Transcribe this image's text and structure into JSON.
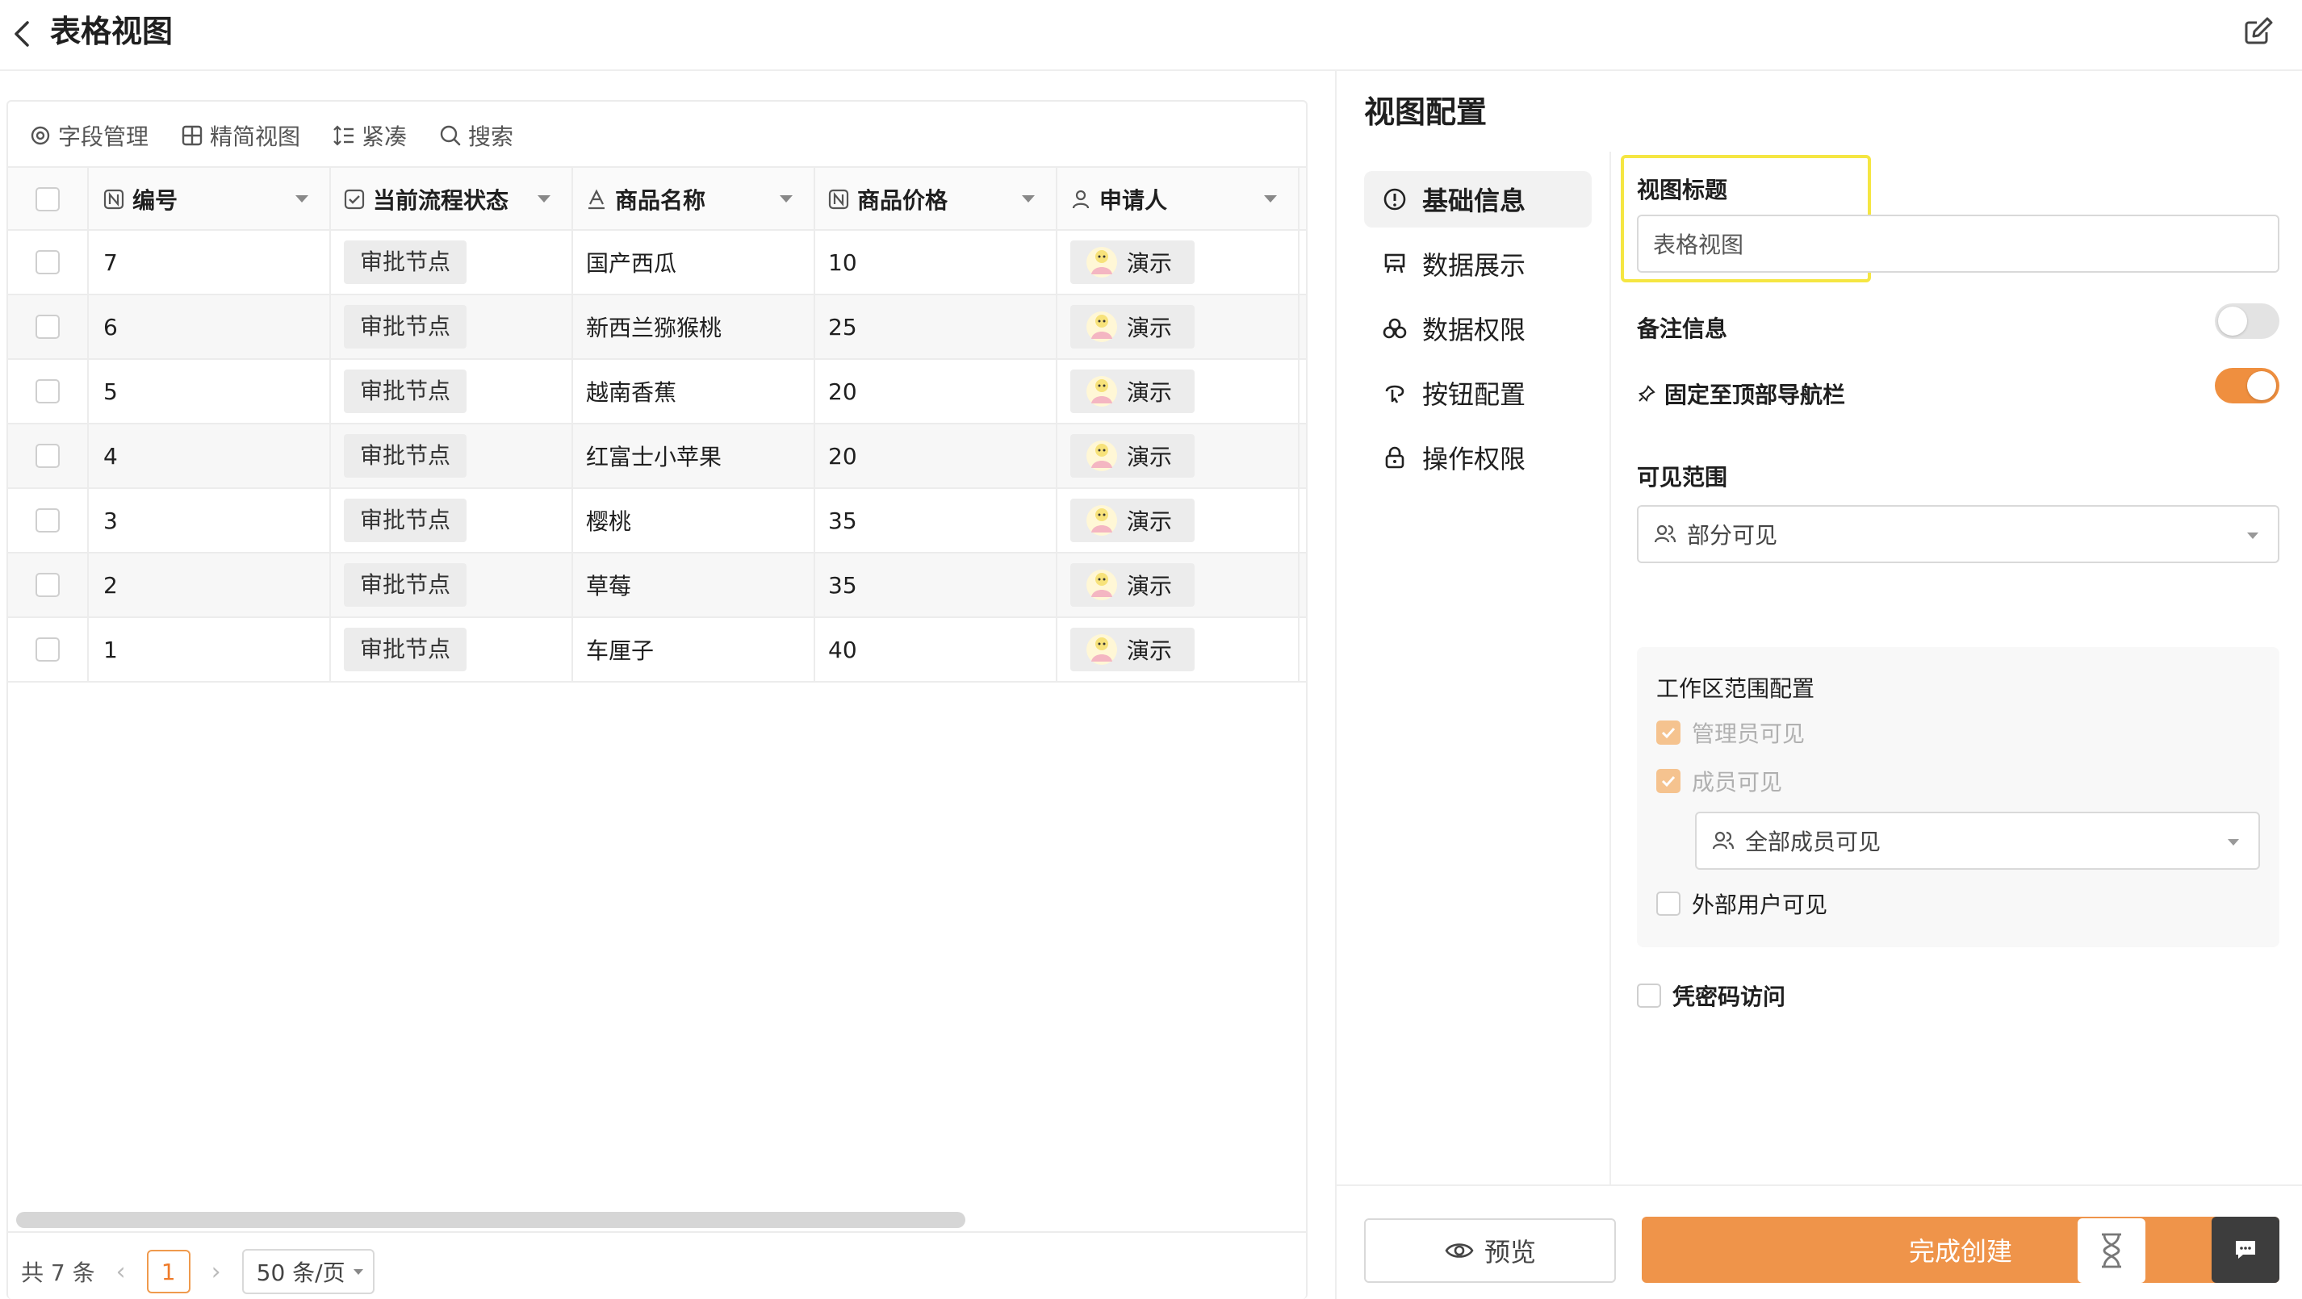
{
  "header": {
    "title": "表格视图",
    "back_icon": "chevron-left-icon",
    "edit_icon": "edit-icon"
  },
  "toolbar": {
    "fields": "字段管理",
    "simple_view": "精简视图",
    "compact": "紧凑",
    "search": "搜索"
  },
  "table": {
    "columns": [
      {
        "label": "编号",
        "icon": "number-field-icon"
      },
      {
        "label": "当前流程状态",
        "icon": "status-field-icon"
      },
      {
        "label": "商品名称",
        "icon": "text-field-icon"
      },
      {
        "label": "商品价格",
        "icon": "number-field-icon"
      },
      {
        "label": "申请人",
        "icon": "user-field-icon"
      }
    ],
    "rows": [
      {
        "id": "7",
        "status": "审批节点",
        "name": "国产西瓜",
        "price": "10",
        "applicant": "演示"
      },
      {
        "id": "6",
        "status": "审批节点",
        "name": "新西兰猕猴桃",
        "price": "25",
        "applicant": "演示"
      },
      {
        "id": "5",
        "status": "审批节点",
        "name": "越南香蕉",
        "price": "20",
        "applicant": "演示"
      },
      {
        "id": "4",
        "status": "审批节点",
        "name": "红富士小苹果",
        "price": "20",
        "applicant": "演示"
      },
      {
        "id": "3",
        "status": "审批节点",
        "name": "樱桃",
        "price": "35",
        "applicant": "演示"
      },
      {
        "id": "2",
        "status": "审批节点",
        "name": "草莓",
        "price": "35",
        "applicant": "演示"
      },
      {
        "id": "1",
        "status": "审批节点",
        "name": "车厘子",
        "price": "40",
        "applicant": "演示"
      }
    ]
  },
  "pagination": {
    "total": "共 7 条",
    "current": "1",
    "page_size": "50 条/页"
  },
  "config": {
    "title": "视图配置",
    "menu": [
      {
        "label": "基础信息",
        "icon": "info-icon",
        "active": true
      },
      {
        "label": "数据展示",
        "icon": "presentation-icon",
        "active": false
      },
      {
        "label": "数据权限",
        "icon": "data-permission-icon",
        "active": false
      },
      {
        "label": "按钮配置",
        "icon": "button-config-icon",
        "active": false
      },
      {
        "label": "操作权限",
        "icon": "lock-icon",
        "active": false
      }
    ],
    "view_title_label": "视图标题",
    "view_title_value": "表格视图",
    "remark_label": "备注信息",
    "remark_enabled": false,
    "pin_label": "固定至顶部导航栏",
    "pin_enabled": true,
    "visibility_label": "可见范围",
    "visibility_value": "部分可见",
    "workspace_title": "工作区范围配置",
    "admin_visible": "管理员可见",
    "member_visible": "成员可见",
    "member_scope_value": "全部成员可见",
    "external_visible": "外部用户可见",
    "password_access": "凭密码访问",
    "preview_label": "预览",
    "create_label": "完成创建"
  },
  "colors": {
    "accent": "#ef944a",
    "highlight": "#f5e642"
  }
}
